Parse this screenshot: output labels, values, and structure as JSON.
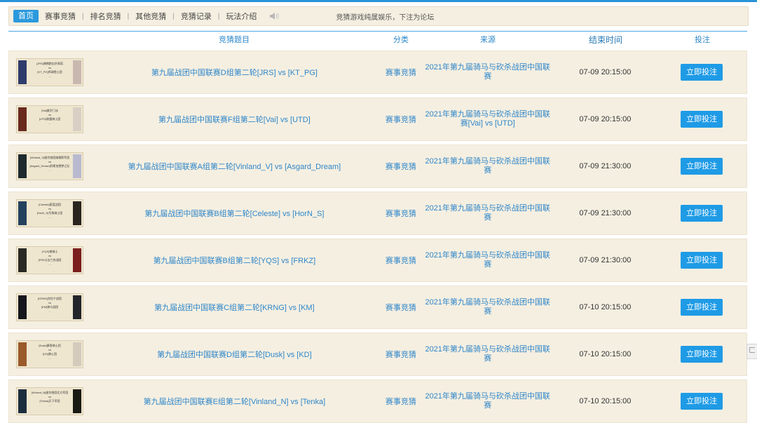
{
  "nav": {
    "items": [
      {
        "label": "首页",
        "active": true
      },
      {
        "label": "赛事竞猜",
        "active": false
      },
      {
        "label": "排名竞猜",
        "active": false
      },
      {
        "label": "其他竞猜",
        "active": false
      },
      {
        "label": "竞猜记录",
        "active": false
      },
      {
        "label": "玩法介绍",
        "active": false
      }
    ],
    "speaker_icon": "speaker-icon",
    "notice": "竞猜游戏纯属娱乐，下注为论坛"
  },
  "table": {
    "headers": {
      "title": "竞猜题目",
      "category": "分类",
      "source": "来源",
      "end_time": "结束时间",
      "action": "投注"
    },
    "rows": [
      {
        "thumb_lines": [
          "[JRS]骑猪跑出京高塔",
          "vs",
          "[KT_PG]鸡球猎士团",
          "..."
        ],
        "title": "第九届战团中国联赛D组第二轮[JRS] vs [KT_PG]",
        "category": "赛事竞猜",
        "source": "2021年第九届骑马与砍杀战团中国联赛",
        "end_time": "07-09 20:15:00",
        "button": "立即投注",
        "flag_left": "#2f3b6a",
        "flag_right": "#c9b8b0"
      },
      {
        "thumb_lines": [
          "[Vai]维京门派",
          "vs",
          "[UTD]联盟骑士团",
          "..."
        ],
        "title": "第九届战团中国联赛F组第二轮[Vai] vs [UTD]",
        "category": "赛事竞猜",
        "source": "2021年第九届骑马与砍杀战团中国联赛[Vai] vs [UTD]",
        "end_time": "07-09 20:15:00",
        "button": "立即投注",
        "flag_left": "#6a2a1e",
        "flag_right": "#d9cfc4"
      },
      {
        "thumb_lines": [
          "[Vinland_V]维京旅团维格斯军团",
          "vs",
          "[Asgard_Dream]阿斯加德梦之队",
          "..."
        ],
        "title": "第九届战团中国联赛A组第二轮[Vinland_V] vs [Asgard_Dream]",
        "category": "赛事竞猜",
        "source": "2021年第九届骑马与砍杀战团中国联赛",
        "end_time": "07-09 21:30:00",
        "button": "立即投注",
        "flag_left": "#1e2a2e",
        "flag_right": "#b9b9cf"
      },
      {
        "thumb_lines": [
          "[Celeste]蔚蓝战团",
          "vs",
          "[HorN_S]号角骑士团",
          "..."
        ],
        "title": "第九届战团中国联赛B组第二轮[Celeste] vs [HorN_S]",
        "category": "赛事竞猜",
        "source": "2021年第九届骑马与砍杀战团中国联赛",
        "end_time": "07-09 21:30:00",
        "button": "立即投注",
        "flag_left": "#24425e",
        "flag_right": "#2a2420"
      },
      {
        "thumb_lines": [
          "[YQS]夜骑士",
          "vs",
          "[FRKZ]法兰克战团",
          "..."
        ],
        "title": "第九届战团中国联赛B组第二轮[YQS] vs [FRKZ]",
        "category": "赛事竞猜",
        "source": "2021年第九届骑马与砍杀战团中国联赛",
        "end_time": "07-09 21:30:00",
        "button": "立即投注",
        "flag_left": "#2a2a24",
        "flag_right": "#7a1e1e"
      },
      {
        "thumb_lines": [
          "[KRNG]克拉宁战团",
          "vs",
          "[KM]骑马战团",
          "..."
        ],
        "title": "第九届战团中国联赛C组第二轮[KRNG] vs [KM]",
        "category": "赛事竞猜",
        "source": "2021年第九届骑马与砍杀战团中国联赛",
        "end_time": "07-10 20:15:00",
        "button": "立即投注",
        "flag_left": "#15171c",
        "flag_right": "#23252a"
      },
      {
        "thumb_lines": [
          "[Dusk]黄昏骑士团",
          "vs",
          "[KD]骑士团",
          "..."
        ],
        "title": "第九届战团中国联赛D组第二轮[Dusk] vs [KD]",
        "category": "赛事竞猜",
        "source": "2021年第九届骑马与砍杀战团中国联赛",
        "end_time": "07-10 20:15:00",
        "button": "立即投注",
        "flag_left": "#9a5a2a",
        "flag_right": "#d4cbbd"
      },
      {
        "thumb_lines": [
          "[Vinland_N]维京旅团北方军团",
          "vs",
          "[Tenka]天下军团",
          "..."
        ],
        "title": "第九届战团中国联赛E组第二轮[Vinland_N] vs [Tenka]",
        "category": "赛事竞猜",
        "source": "2021年第九届骑马与砍杀战团中国联赛",
        "end_time": "07-10 20:15:00",
        "button": "立即投注",
        "flag_left": "#1c2d3e",
        "flag_right": "#1a1a14"
      }
    ]
  },
  "side_tab": {
    "icon": "collapse-icon",
    "glyph": "ㄈ"
  },
  "colors": {
    "accent": "#2b99dd",
    "row_bg": "#f5efe1",
    "link": "#2f86c9"
  }
}
